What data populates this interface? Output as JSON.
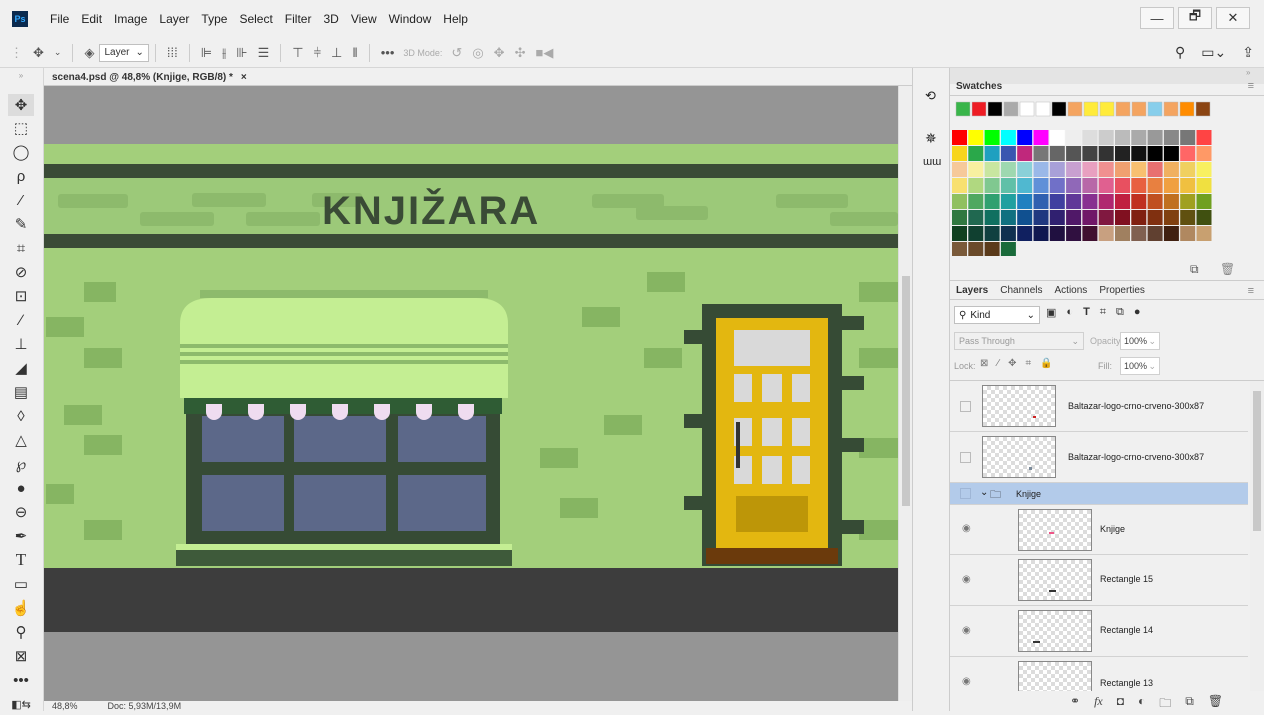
{
  "app": {
    "logo": "Ps"
  },
  "menu": [
    "File",
    "Edit",
    "Image",
    "Layer",
    "Type",
    "Select",
    "Filter",
    "3D",
    "View",
    "Window",
    "Help"
  ],
  "window_controls": {
    "minimize": "—",
    "restore": "🗗",
    "close": "✕"
  },
  "options_bar": {
    "layer_select": "Layer",
    "mode_3d": "3D Mode:"
  },
  "document": {
    "tab_title": "scena4.psd @ 48,8% (Knjige, RGB/8) *",
    "close": "×",
    "sign_text": "KNJIŽARA"
  },
  "status": {
    "zoom": "48,8%",
    "doc": "Doc: 5,93M/13,9M"
  },
  "swatches_panel": {
    "title": "Swatches"
  },
  "layers_panel": {
    "tabs": [
      "Layers",
      "Channels",
      "Actions",
      "Properties"
    ],
    "filter_kind": "Kind",
    "blend_mode": "Pass Through",
    "opacity_label": "Opacity:",
    "opacity_value": "100%",
    "lock_label": "Lock:",
    "fill_label": "Fill:",
    "fill_value": "100%",
    "layers": [
      {
        "name": "Baltazar-logo-crno-crveno-300x87",
        "visible": false
      },
      {
        "name": "Baltazar-logo-crno-crveno-300x87",
        "visible": false
      },
      {
        "name": "Knjige",
        "group": true,
        "selected": true
      },
      {
        "name": "Knjige",
        "visible": true
      },
      {
        "name": "Rectangle 15",
        "visible": true
      },
      {
        "name": "Rectangle 14",
        "visible": true
      },
      {
        "name": "Rectangle 13",
        "visible": true
      }
    ]
  },
  "colors": {
    "wall": "#a3cf7b",
    "dark_green": "#3a4b36",
    "shop_dark": "#364b35",
    "road": "#3d3d3d",
    "door": "#e3b710",
    "awning": "#c4ee93"
  }
}
